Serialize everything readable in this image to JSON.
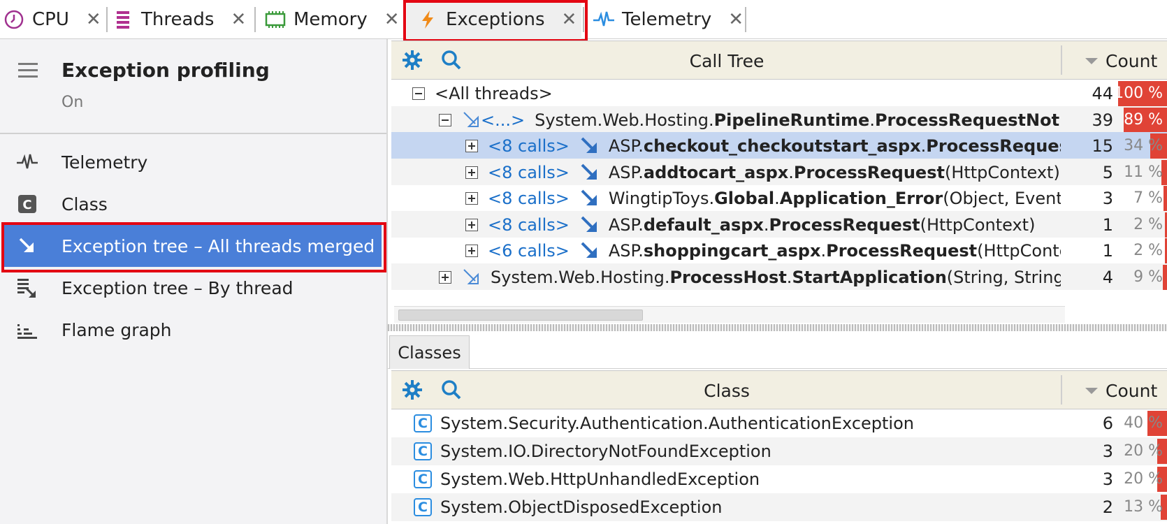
{
  "tabs": [
    {
      "label": "CPU",
      "icon": "clock-icon"
    },
    {
      "label": "Threads",
      "icon": "threads-icon"
    },
    {
      "label": "Memory",
      "icon": "memory-chip-icon"
    },
    {
      "label": "Exceptions",
      "icon": "lightning-icon",
      "active": true
    },
    {
      "label": "Telemetry",
      "icon": "pulse-icon"
    }
  ],
  "sidebar": {
    "title": "Exception profiling",
    "status": "On",
    "items": [
      {
        "label": "Telemetry",
        "icon": "pulse-icon"
      },
      {
        "label": "Class",
        "icon": "class-icon"
      },
      {
        "label": "Exception tree – All threads merged",
        "icon": "arrow-down-right-icon",
        "selected": true
      },
      {
        "label": "Exception tree – By thread",
        "icon": "tree-by-thread-icon"
      },
      {
        "label": "Flame graph",
        "icon": "flame-graph-icon"
      }
    ]
  },
  "call_tree": {
    "header": {
      "title": "Call Tree",
      "count": "Count"
    },
    "rows": [
      {
        "prefix": "<All threads>",
        "parts": [],
        "count": "44",
        "pct": "100 %",
        "pct_value": 100
      },
      {
        "calls": "<...>",
        "parts": [
          [
            "System.Web.Hosting.",
            false
          ],
          [
            "PipelineRuntime",
            true
          ],
          [
            ".",
            false
          ],
          [
            "ProcessRequestNotif",
            true
          ]
        ],
        "count": "39",
        "pct": "89 %",
        "pct_value": 89
      },
      {
        "calls": "<8 calls>",
        "parts": [
          [
            "ASP.",
            false
          ],
          [
            "checkout_checkoutstart_aspx",
            true
          ],
          [
            ".",
            false
          ],
          [
            "ProcessRequest",
            true
          ]
        ],
        "count": "15",
        "pct": "34 %",
        "pct_value": 34
      },
      {
        "calls": "<8 calls>",
        "parts": [
          [
            "ASP.",
            false
          ],
          [
            "addtocart_aspx",
            true
          ],
          [
            ".",
            false
          ],
          [
            "ProcessRequest",
            true
          ],
          [
            "(HttpContext)",
            false
          ]
        ],
        "count": "5",
        "pct": "11 %",
        "pct_value": 11
      },
      {
        "calls": "<8 calls>",
        "parts": [
          [
            "WingtipToys.",
            false
          ],
          [
            "Global",
            true
          ],
          [
            ".",
            false
          ],
          [
            "Application_Error",
            true
          ],
          [
            "(Object, EventA",
            false
          ]
        ],
        "count": "3",
        "pct": "7 %",
        "pct_value": 7
      },
      {
        "calls": "<8 calls>",
        "parts": [
          [
            "ASP.",
            false
          ],
          [
            "default_aspx",
            true
          ],
          [
            ".",
            false
          ],
          [
            "ProcessRequest",
            true
          ],
          [
            "(HttpContext)",
            false
          ]
        ],
        "count": "1",
        "pct": "2 %",
        "pct_value": 2
      },
      {
        "calls": "<6 calls>",
        "parts": [
          [
            "ASP.",
            false
          ],
          [
            "shoppingcart_aspx",
            true
          ],
          [
            ".",
            false
          ],
          [
            "ProcessRequest",
            true
          ],
          [
            "(HttpConte",
            false
          ]
        ],
        "count": "1",
        "pct": "2 %",
        "pct_value": 2
      },
      {
        "parts": [
          [
            "System.Web.Hosting.",
            false
          ],
          [
            "ProcessHost",
            true
          ],
          [
            ".",
            false
          ],
          [
            "StartApplication",
            true
          ],
          [
            "(String, String",
            false
          ]
        ],
        "count": "4",
        "pct": "9 %",
        "pct_value": 9
      }
    ]
  },
  "classes_tab": "Classes",
  "classes": {
    "header": {
      "title": "Class",
      "count": "Count"
    },
    "rows": [
      {
        "name": "System.Security.Authentication.AuthenticationException",
        "count": "6",
        "pct": "40 %",
        "pct_value": 40
      },
      {
        "name": "System.IO.DirectoryNotFoundException",
        "count": "3",
        "pct": "20 %",
        "pct_value": 20
      },
      {
        "name": "System.Web.HttpUnhandledException",
        "count": "3",
        "pct": "20 %",
        "pct_value": 20
      },
      {
        "name": "System.ObjectDisposedException",
        "count": "2",
        "pct": "13 %",
        "pct_value": 13
      }
    ]
  },
  "colors": {
    "accent": "#4a7fd8",
    "percent_bar": "#e04336",
    "highlight_box": "#e30613",
    "link": "#1a6fc9"
  }
}
